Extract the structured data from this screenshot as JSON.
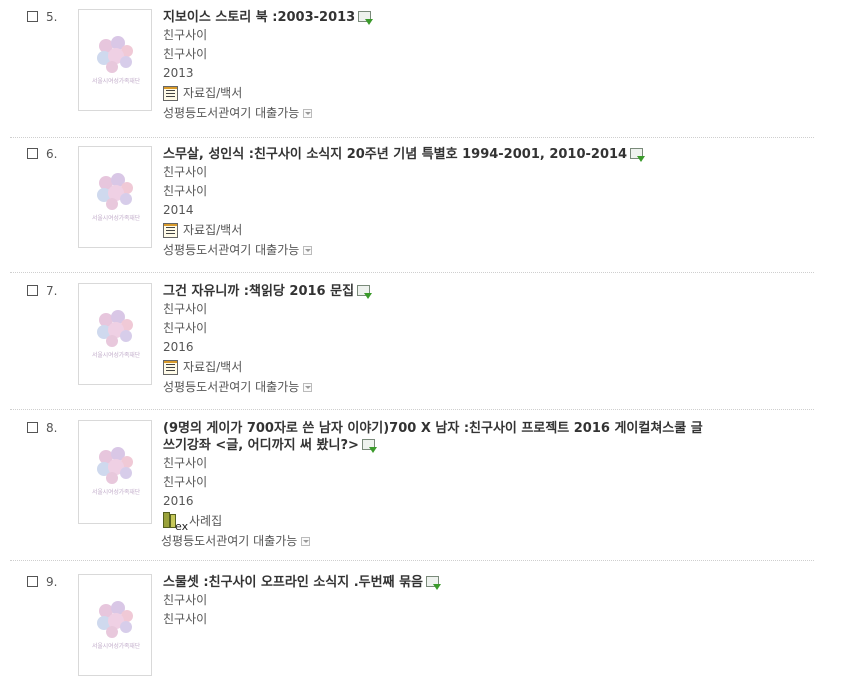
{
  "results": [
    {
      "number": "5.",
      "title": "지보이스 스토리 북 :2003-2013",
      "author": "친구사이",
      "publisher": "친구사이",
      "year": "2013",
      "type": "자료집/백서",
      "type_icon": "document-icon",
      "availability": "성평등도서관여기 대출가능",
      "thumbnail_caption": "서울시여성가족재단"
    },
    {
      "number": "6.",
      "title": "스무살, 성인식 :친구사이 소식지 20주년 기념 특별호 1994-2001, 2010-2014",
      "author": "친구사이",
      "publisher": "친구사이",
      "year": "2014",
      "type": "자료집/백서",
      "type_icon": "document-icon",
      "availability": "성평등도서관여기 대출가능",
      "thumbnail_caption": "서울시여성가족재단"
    },
    {
      "number": "7.",
      "title": "그건 자유니까 :책읽당 2016 문집",
      "author": "친구사이",
      "publisher": "친구사이",
      "year": "2016",
      "type": "자료집/백서",
      "type_icon": "document-icon",
      "availability": "성평등도서관여기 대출가능",
      "thumbnail_caption": "서울시여성가족재단"
    },
    {
      "number": "8.",
      "title_line1": "(9명의 게이가 700자로 쓴 남자 이야기)700 X 남자 :친구사이 프로젝트 2016 게이컬쳐스쿨 글",
      "title_line2": "쓰기강좌 <글, 어디까지 써 봤니?>",
      "author": "친구사이",
      "publisher": "친구사이",
      "year": "2016",
      "type": "사례집",
      "type_icon_text": "ex",
      "type_icon": "books-icon",
      "availability": "성평등도서관여기 대출가능",
      "thumbnail_caption": "서울시여성가족재단"
    },
    {
      "number": "9.",
      "title": "스물셋 :친구사이 오프라인 소식지 .두번째 묶음",
      "author": "친구사이",
      "publisher": "친구사이",
      "thumbnail_caption": "서울시여성가족재단"
    }
  ]
}
